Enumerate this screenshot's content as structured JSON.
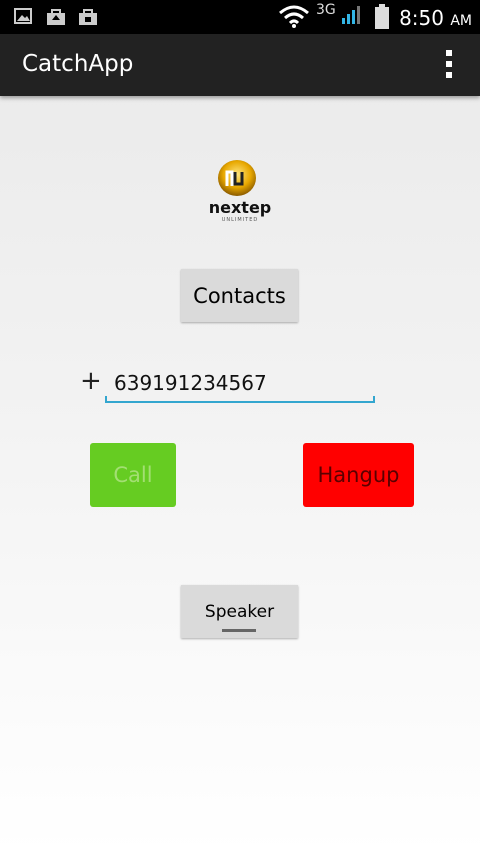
{
  "status_bar": {
    "time": "8:50",
    "ampm": "AM",
    "network": "3G",
    "icons": [
      "image-icon",
      "briefcase-upload-icon",
      "briefcase-icon",
      "wifi-icon",
      "signal-icon",
      "battery-icon"
    ]
  },
  "action_bar": {
    "title": "CatchApp",
    "menu_icon": "overflow-menu-icon"
  },
  "logo": {
    "brand": "nextep",
    "sub": "UNLIMITED"
  },
  "buttons": {
    "contacts": "Contacts",
    "call": "Call",
    "hangup": "Hangup",
    "speaker": "Speaker"
  },
  "phone": {
    "prefix": "+",
    "value": "639191234567"
  },
  "colors": {
    "call": "#66cc22",
    "hangup": "#ff0000",
    "accent": "#33a6cf"
  }
}
